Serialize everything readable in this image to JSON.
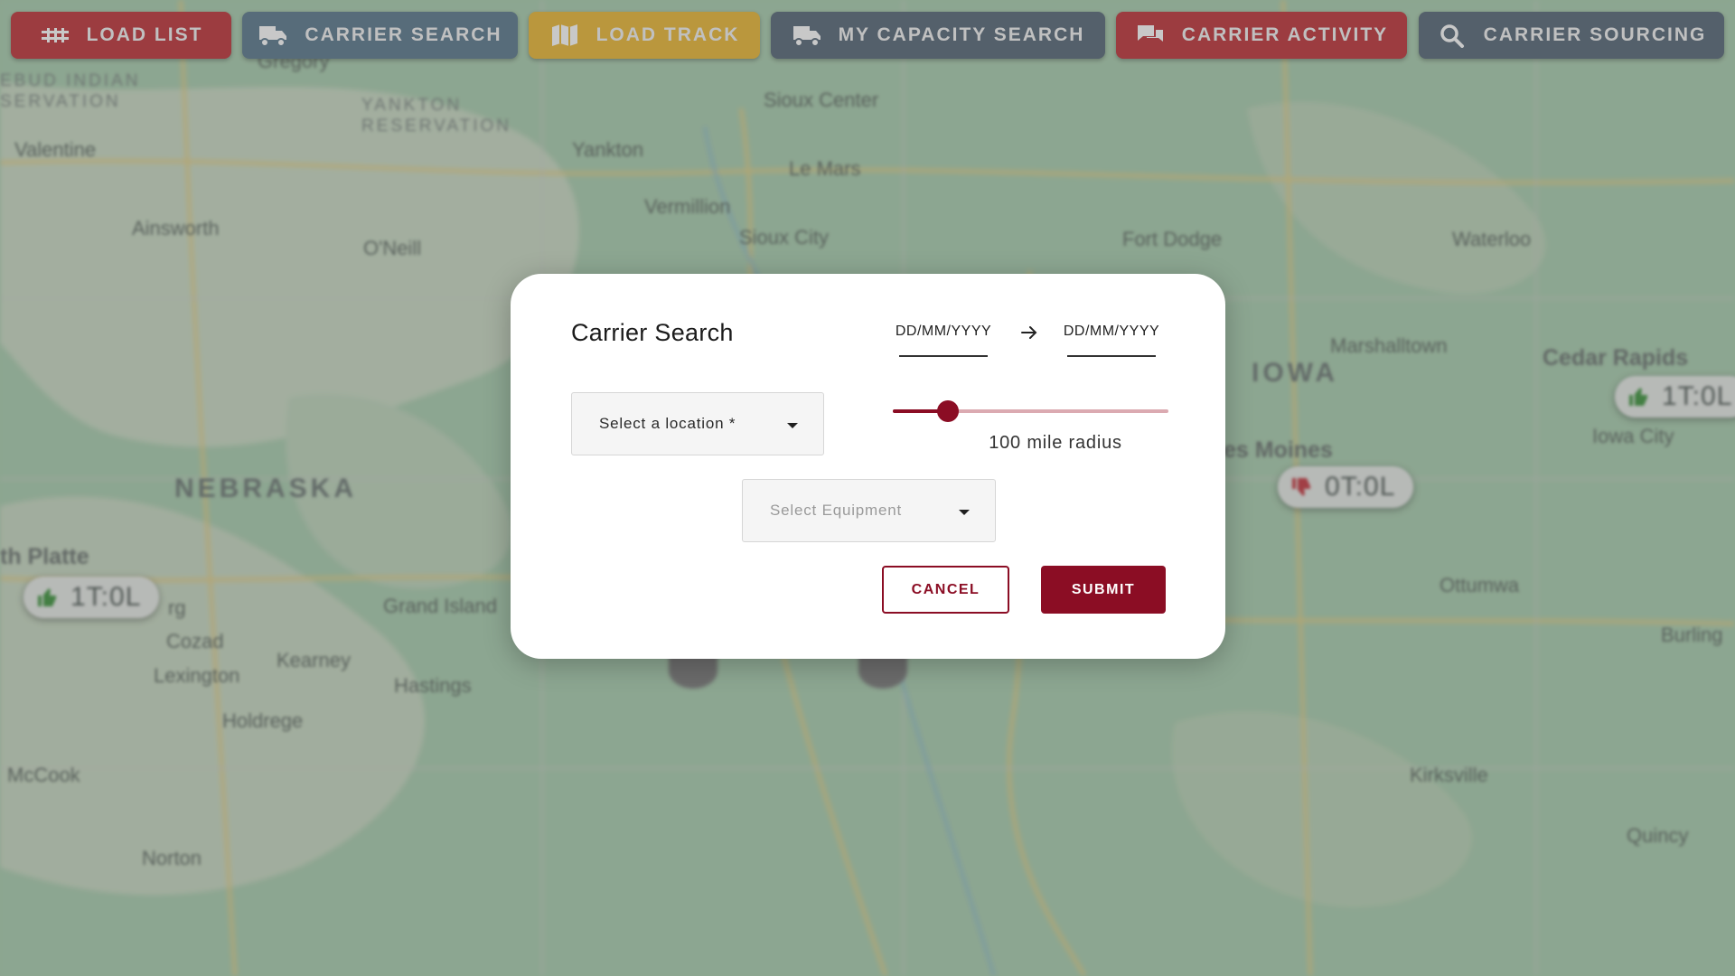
{
  "tabs": [
    {
      "label": "LOAD LIST",
      "icon": "list-icon",
      "color": "#b81d24"
    },
    {
      "label": "CARRIER SEARCH",
      "icon": "truck-icon",
      "color": "#4a6b82"
    },
    {
      "label": "LOAD TRACK",
      "icon": "map-icon",
      "color": "#e8b020"
    },
    {
      "label": "MY CAPACITY SEARCH",
      "icon": "truck-icon",
      "color": "#44586a"
    },
    {
      "label": "CARRIER ACTIVITY",
      "icon": "chat-icon",
      "color": "#b81d24"
    },
    {
      "label": "CARRIER SOURCING",
      "icon": "search-icon",
      "color": "#44586a"
    }
  ],
  "map": {
    "states": [
      "NEBRASKA",
      "IOWA"
    ],
    "reservations": [
      "EBUD INDIAN\nSERVATION",
      "YANKTON\nRESERVATION"
    ],
    "cities": [
      "Valentine",
      "Ainsworth",
      "O'Neill",
      "Yankton",
      "Sioux Center",
      "Le Mars",
      "Vermillion",
      "Sioux City",
      "Fort Dodge",
      "Waterloo",
      "Marshalltown",
      "Cedar Rapids",
      "Iowa City",
      "es Moines",
      "Ottumwa",
      "Burling",
      "Grand Island",
      "Kearney",
      "Hastings",
      "Cozad",
      "Lexington",
      "Holdrege",
      "McCook",
      "Norton",
      "Kirksville",
      "Quincy",
      "th Platte",
      "rg",
      "Gregory"
    ],
    "markers": [
      "1T:0L",
      "0T:0L",
      "1T:0L"
    ]
  },
  "modal": {
    "title": "Carrier Search",
    "date_from_placeholder": "DD/MM/YYYY",
    "date_to_placeholder": "DD/MM/YYYY",
    "location_placeholder": "Select a location *",
    "equipment_placeholder": "Select Equipment",
    "radius_value": 100,
    "radius_max": 500,
    "radius_label": "100 mile radius",
    "cancel_label": "CANCEL",
    "submit_label": "SUBMIT",
    "accent_color": "#8b0d24"
  }
}
